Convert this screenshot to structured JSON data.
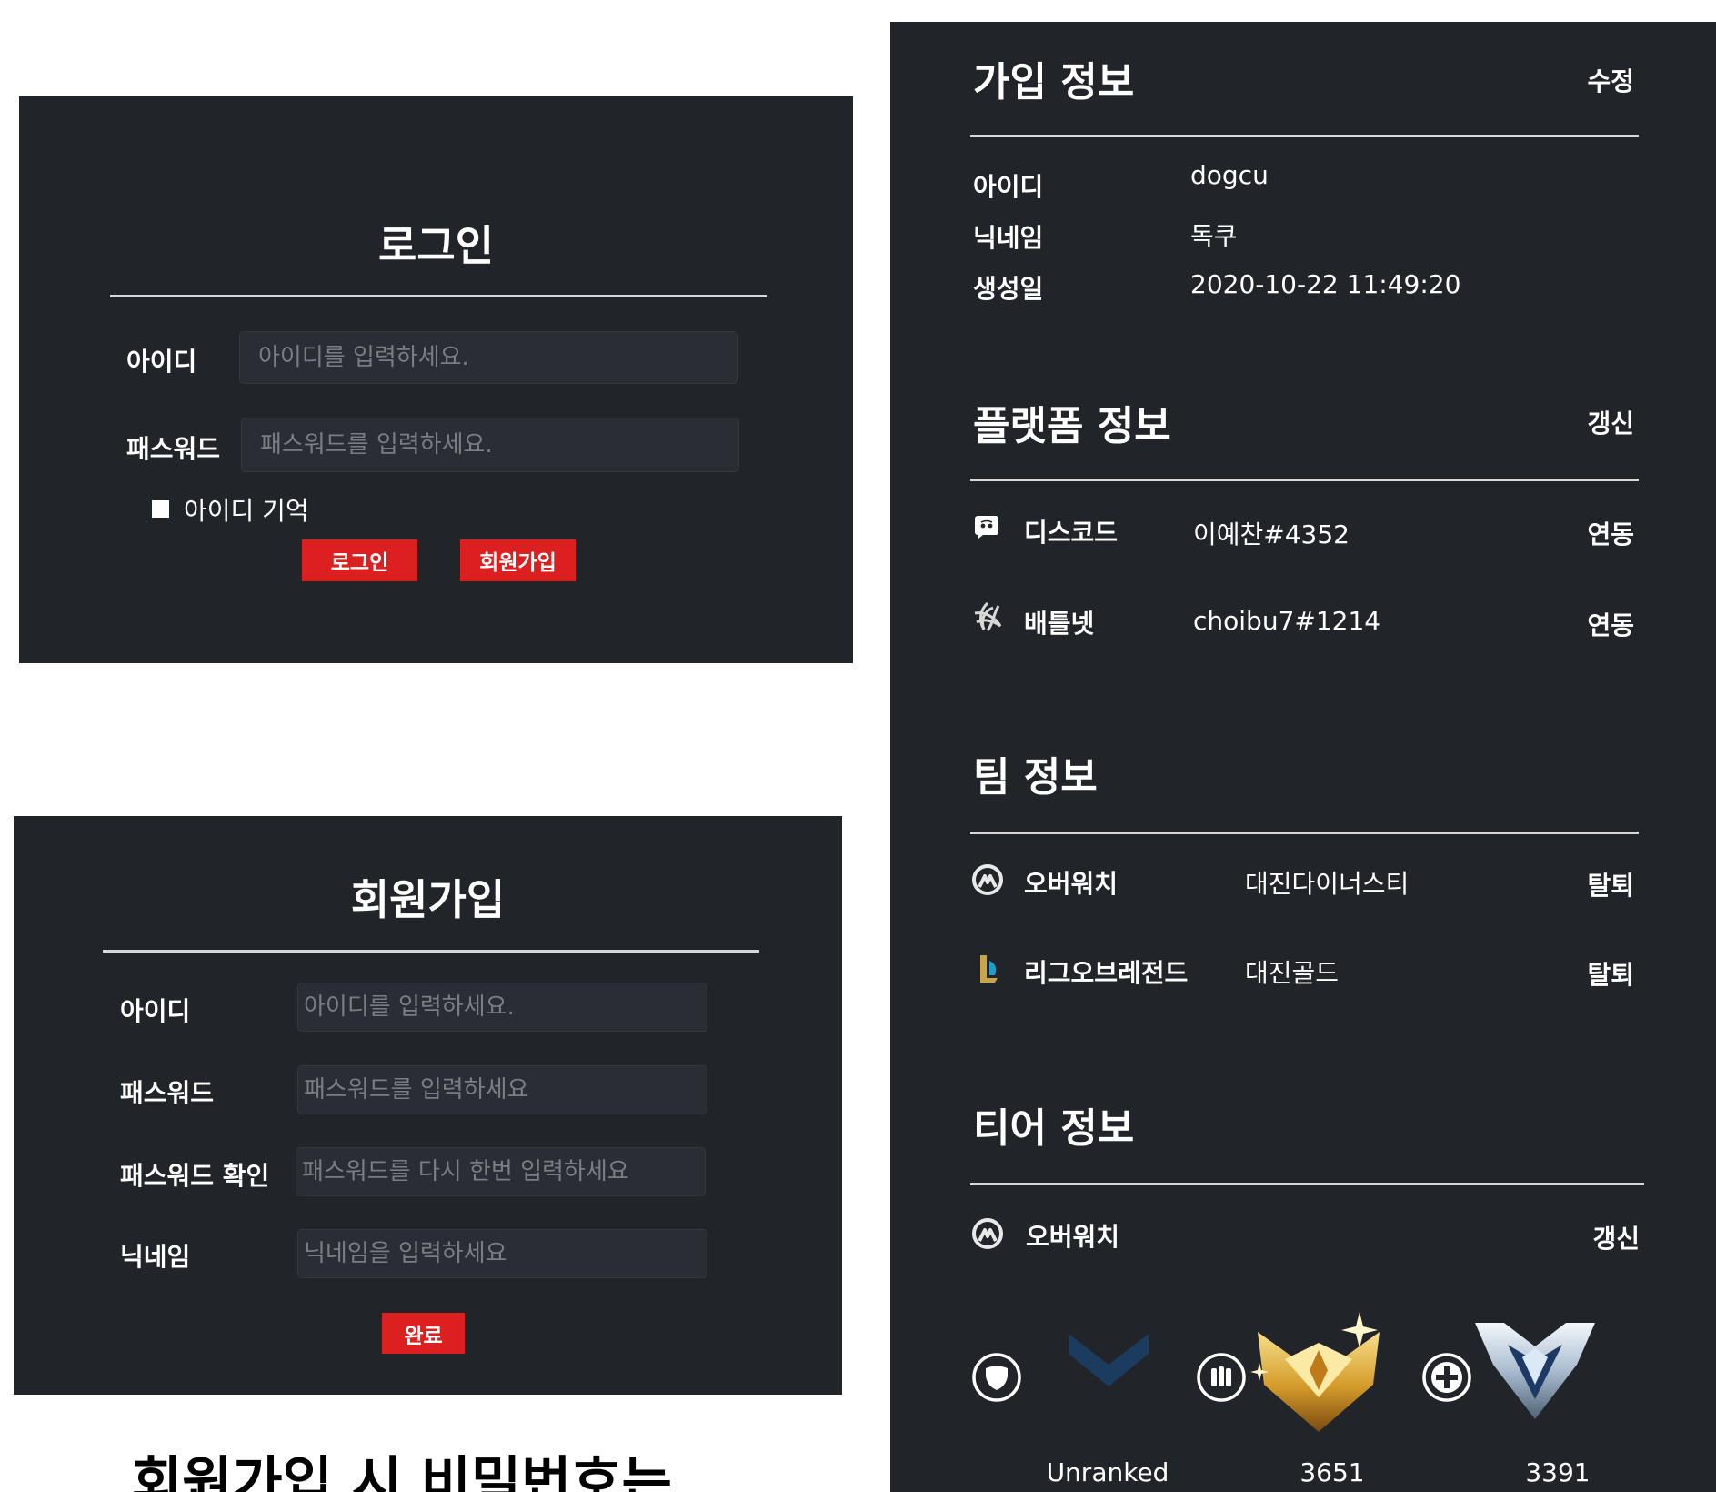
{
  "login": {
    "title": "로그인",
    "id_label": "아이디",
    "id_placeholder": "아이디를 입력하세요.",
    "pw_label": "패스워드",
    "pw_placeholder": "패스워드를 입력하세요.",
    "remember_label": "아이디 기억",
    "login_button": "로그인",
    "signup_button": "회원가입"
  },
  "signup": {
    "title": "회원가입",
    "id_label": "아이디",
    "id_placeholder": "아이디를 입력하세요.",
    "pw_label": "패스워드",
    "pw_placeholder": "패스워드를 입력하세요",
    "pw_confirm_label": "패스워드 확인",
    "pw_confirm_placeholder": "패스워드를 다시 한번 입력하세요",
    "nick_label": "닉네임",
    "nick_placeholder": "닉네임을 입력하세요",
    "done_button": "완료"
  },
  "caption": "회원가입 시 비밀번호는",
  "profile": {
    "join": {
      "title": "가입 정보",
      "action": "수정",
      "rows": [
        {
          "label": "아이디",
          "value": "dogcu"
        },
        {
          "label": "닉네임",
          "value": "독쿠"
        },
        {
          "label": "생성일",
          "value": "2020-10-22 11:49:20"
        }
      ]
    },
    "platform": {
      "title": "플랫폼 정보",
      "action": "갱신",
      "rows": [
        {
          "icon": "discord-icon",
          "label": "디스코드",
          "value": "이예찬#4352",
          "action": "연동"
        },
        {
          "icon": "battlenet-icon",
          "label": "배틀넷",
          "value": "choibu7#1214",
          "action": "연동"
        }
      ]
    },
    "team": {
      "title": "팀 정보",
      "rows": [
        {
          "icon": "overwatch-icon",
          "label": "오버워치",
          "value": "대진다이너스티",
          "action": "탈퇴"
        },
        {
          "icon": "league-of-legends-icon",
          "label": "리그오브레전드",
          "value": "대진골드",
          "action": "탈퇴"
        }
      ]
    },
    "tier": {
      "title": "티어 정보",
      "game": "오버워치",
      "action": "갱신",
      "roles": [
        {
          "role_icon": "tank-role-icon",
          "rank_icon": "unranked-icon",
          "value": "Unranked"
        },
        {
          "role_icon": "damage-role-icon",
          "rank_icon": "master-rank-icon",
          "value": "3651"
        },
        {
          "role_icon": "support-role-icon",
          "rank_icon": "diamond-rank-icon",
          "value": "3391"
        }
      ]
    }
  },
  "colors": {
    "panel_bg": "#212429",
    "accent_red": "#dc1f1f",
    "divider": "#d8d8d8"
  }
}
